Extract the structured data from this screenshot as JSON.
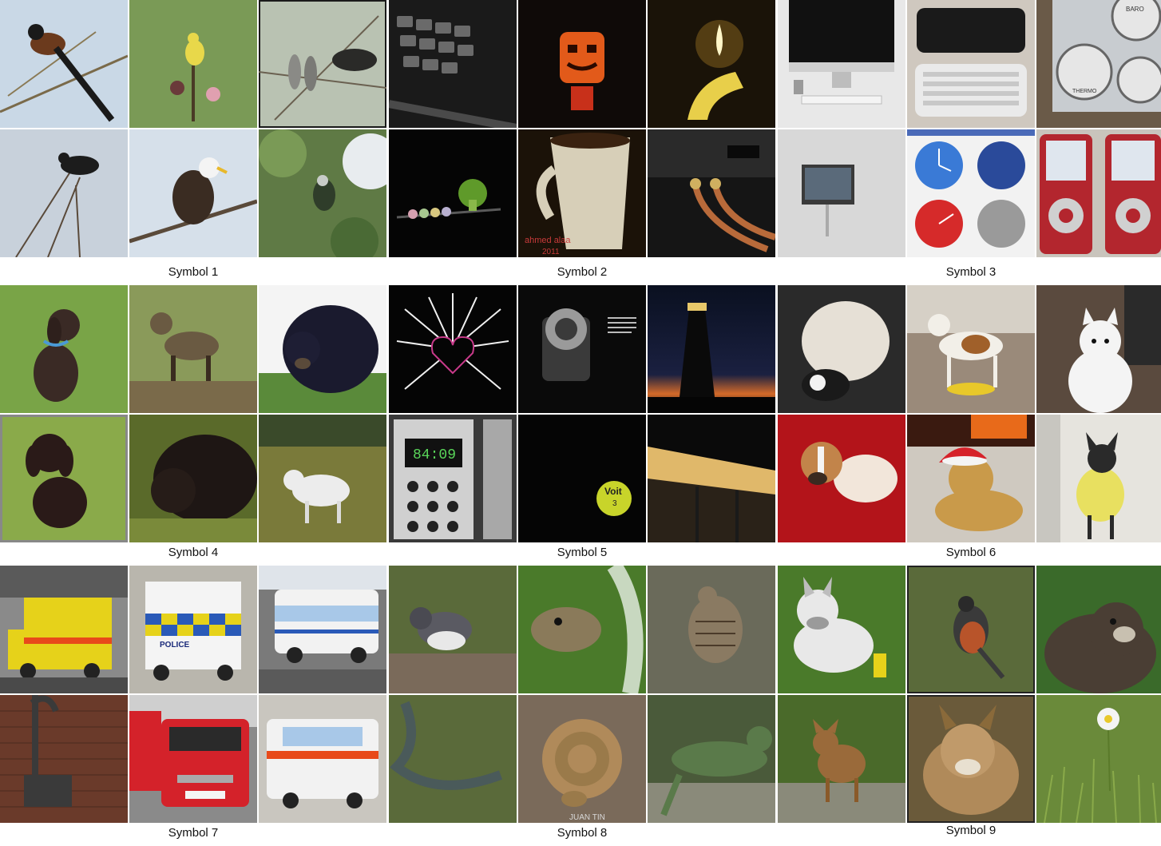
{
  "panels": [
    {
      "caption": "Symbol 1",
      "tiles": [
        {
          "bg": "#c9d8e6",
          "fg": "#6b3a1d"
        },
        {
          "bg": "#7a9a56",
          "fg": "#e8d84a"
        },
        {
          "bg": "#b9c2b2",
          "fg": "#2a2a28"
        },
        {
          "bg": "#c8d1db",
          "fg": "#1c1c1c"
        },
        {
          "bg": "#d6e0ea",
          "fg": "#3a2c22"
        },
        {
          "bg": "#5f7a45",
          "fg": "#2f3d2a"
        }
      ]
    },
    {
      "caption": "Symbol 2",
      "tiles": [
        {
          "bg": "#1a1a1a",
          "fg": "#6a6a6a"
        },
        {
          "bg": "#0f0a08",
          "fg": "#e25a1a"
        },
        {
          "bg": "#1a1308",
          "fg": "#e8cf4a"
        },
        {
          "bg": "#050505",
          "fg": "#5f9a2a"
        },
        {
          "bg": "#1b1208",
          "fg": "#d7cfb8"
        },
        {
          "bg": "#151515",
          "fg": "#b86a3a"
        }
      ],
      "texts": [
        "ahmed alaa",
        "2011"
      ]
    },
    {
      "caption": "Symbol 3",
      "tiles": [
        {
          "bg": "#e8e8e8",
          "fg": "#111111"
        },
        {
          "bg": "#cfc8bf",
          "fg": "#1a1a1a"
        },
        {
          "bg": "#6a5a48",
          "fg": "#e6e6e6"
        },
        {
          "bg": "#d8d8d8",
          "fg": "#5a6a7a"
        },
        {
          "bg": "#f2f2f2",
          "fg": "#3a7ad6"
        },
        {
          "bg": "#c9c4bc",
          "fg": "#b3262e"
        }
      ],
      "texts": [
        "BARO",
        "THERMO"
      ]
    },
    {
      "caption": "Symbol 4",
      "tiles": [
        {
          "bg": "#79a447",
          "fg": "#3a2a25"
        },
        {
          "bg": "#8a9a5a",
          "fg": "#6a5a42"
        },
        {
          "bg": "#5a8a3a",
          "fg": "#1a1a2e"
        },
        {
          "bg": "#8aaa4a",
          "fg": "#2a1a18"
        },
        {
          "bg": "#5a6a2a",
          "fg": "#1e1614"
        },
        {
          "bg": "#7a7a3a",
          "fg": "#ececec"
        }
      ]
    },
    {
      "caption": "Symbol 5",
      "tiles": [
        {
          "bg": "#050505",
          "fg": "#f0f0f0"
        },
        {
          "bg": "#0a0a0a",
          "fg": "#9a9a9a"
        },
        {
          "bg": "#0a1020",
          "fg": "#d36a2a"
        },
        {
          "bg": "#3a3a3a",
          "fg": "#d0d0d0"
        },
        {
          "bg": "#050505",
          "fg": "#c8d42a"
        },
        {
          "bg": "#2a2218",
          "fg": "#e0b86a"
        }
      ],
      "texts": [
        "84:09",
        "Voit",
        "3"
      ]
    },
    {
      "caption": "Symbol 6",
      "tiles": [
        {
          "bg": "#2a2a2a",
          "fg": "#e6e0d6"
        },
        {
          "bg": "#9a8a7a",
          "fg": "#f2efe8"
        },
        {
          "bg": "#5a4a3e",
          "fg": "#f4f4f4"
        },
        {
          "bg": "#b3141a",
          "fg": "#c2844a"
        },
        {
          "bg": "#cfc9c0",
          "fg": "#c99a4a"
        },
        {
          "bg": "#e6e4de",
          "fg": "#2a2a2a"
        }
      ]
    },
    {
      "caption": "Symbol 7",
      "tiles": [
        {
          "bg": "#8a8a8a",
          "fg": "#e6d21a"
        },
        {
          "bg": "#b9b6ad",
          "fg": "#2a5ab8"
        },
        {
          "bg": "#7a7a7a",
          "fg": "#f2f2f2"
        },
        {
          "bg": "#6a3a2a",
          "fg": "#3a3a3a"
        },
        {
          "bg": "#8a8a8a",
          "fg": "#d4222a"
        },
        {
          "bg": "#c9c6bf",
          "fg": "#f2f2f2"
        }
      ],
      "texts": [
        "POLICE"
      ]
    },
    {
      "caption": "Symbol 8",
      "tiles": [
        {
          "bg": "#5a6a3a",
          "fg": "#5a5a62"
        },
        {
          "bg": "#4a7a2a",
          "fg": "#8a7a5a"
        },
        {
          "bg": "#6a6a5a",
          "fg": "#8a7a62"
        },
        {
          "bg": "#5a6a3a",
          "fg": "#4a5a5a"
        },
        {
          "bg": "#7a6a5a",
          "fg": "#b08a5a"
        },
        {
          "bg": "#4a5a3a",
          "fg": "#5a7a4a"
        }
      ],
      "texts": [
        "JUAN TIN"
      ]
    },
    {
      "caption": "Symbol 9",
      "tiles": [
        {
          "bg": "#4a7a2a",
          "fg": "#e8e8e8"
        },
        {
          "bg": "#5a6a3a",
          "fg": "#b8542a"
        },
        {
          "bg": "#3a6a2a",
          "fg": "#4a3e34"
        },
        {
          "bg": "#4a6a2a",
          "fg": "#9a6a3a"
        },
        {
          "bg": "#6a5a3a",
          "fg": "#b08a5a"
        },
        {
          "bg": "#6a8a3a",
          "fg": "#f4f4f4"
        }
      ]
    }
  ]
}
